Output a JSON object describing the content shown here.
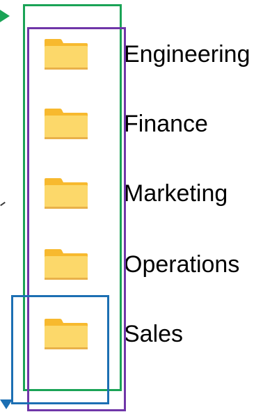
{
  "folders": [
    {
      "label": "Engineering",
      "icon": "folder-icon"
    },
    {
      "label": "Finance",
      "icon": "folder-icon"
    },
    {
      "label": "Marketing",
      "icon": "folder-icon"
    },
    {
      "label": "Operations",
      "icon": "folder-icon"
    },
    {
      "label": "Sales",
      "icon": "folder-icon"
    }
  ],
  "colors": {
    "folder_body": "#FCD86A",
    "folder_tab": "#F7B92E",
    "folder_shadow": "#E9B14A",
    "highlight_green": "#1AA356",
    "highlight_purple": "#6F36A8",
    "highlight_blue": "#1C6FB3"
  }
}
